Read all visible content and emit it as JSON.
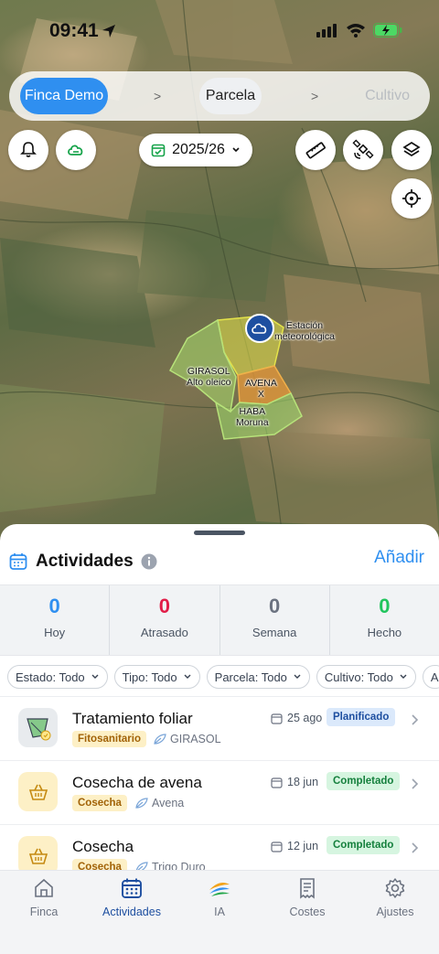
{
  "status_bar": {
    "time": "09:41"
  },
  "breadcrumb": {
    "farm": "Finca Demo",
    "sep1": ">",
    "plot": "Parcela",
    "sep2": ">",
    "crop": "Cultivo"
  },
  "season": {
    "label": "2025/26"
  },
  "map": {
    "station_label_1": "Estación",
    "station_label_2": "meteorológica",
    "fields": [
      {
        "line1": "GIRASOL",
        "line2": "Alto oleico"
      },
      {
        "line1": "AVENA",
        "line2": "X"
      },
      {
        "line1": "HABA",
        "line2": "Moruna"
      }
    ]
  },
  "activities": {
    "title": "Actividades",
    "add_label": "Añadir",
    "stats": [
      {
        "value": "0",
        "label": "Hoy",
        "color": "#2f8ff0"
      },
      {
        "value": "0",
        "label": "Atrasado",
        "color": "#e11d48"
      },
      {
        "value": "0",
        "label": "Semana",
        "color": "#6b7280"
      },
      {
        "value": "0",
        "label": "Hecho",
        "color": "#22c55e"
      }
    ],
    "filters": [
      "Estado: Todo",
      "Tipo: Todo",
      "Parcela: Todo",
      "Cultivo: Todo",
      "A"
    ],
    "items": [
      {
        "title": "Tratamiento foliar",
        "tag": "Fitosanitario",
        "crop": "GIRASOL",
        "date": "25 ago",
        "status": "Planificado"
      },
      {
        "title": "Cosecha de avena",
        "tag": "Cosecha",
        "crop": "Avena",
        "date": "18 jun",
        "status": "Completado"
      },
      {
        "title": "Cosecha",
        "tag": "Cosecha",
        "crop": "Trigo Duro",
        "date": "12 jun",
        "status": "Completado"
      }
    ]
  },
  "tabs": [
    {
      "label": "Finca",
      "icon": "house-icon"
    },
    {
      "label": "Actividades",
      "icon": "calendar-icon"
    },
    {
      "label": "IA",
      "icon": "ia-logo-icon"
    },
    {
      "label": "Costes",
      "icon": "receipt-icon"
    },
    {
      "label": "Ajustes",
      "icon": "gear-icon"
    }
  ],
  "colors": {
    "accent": "#2f8ff0",
    "brand_dark": "#1e4fa0"
  }
}
